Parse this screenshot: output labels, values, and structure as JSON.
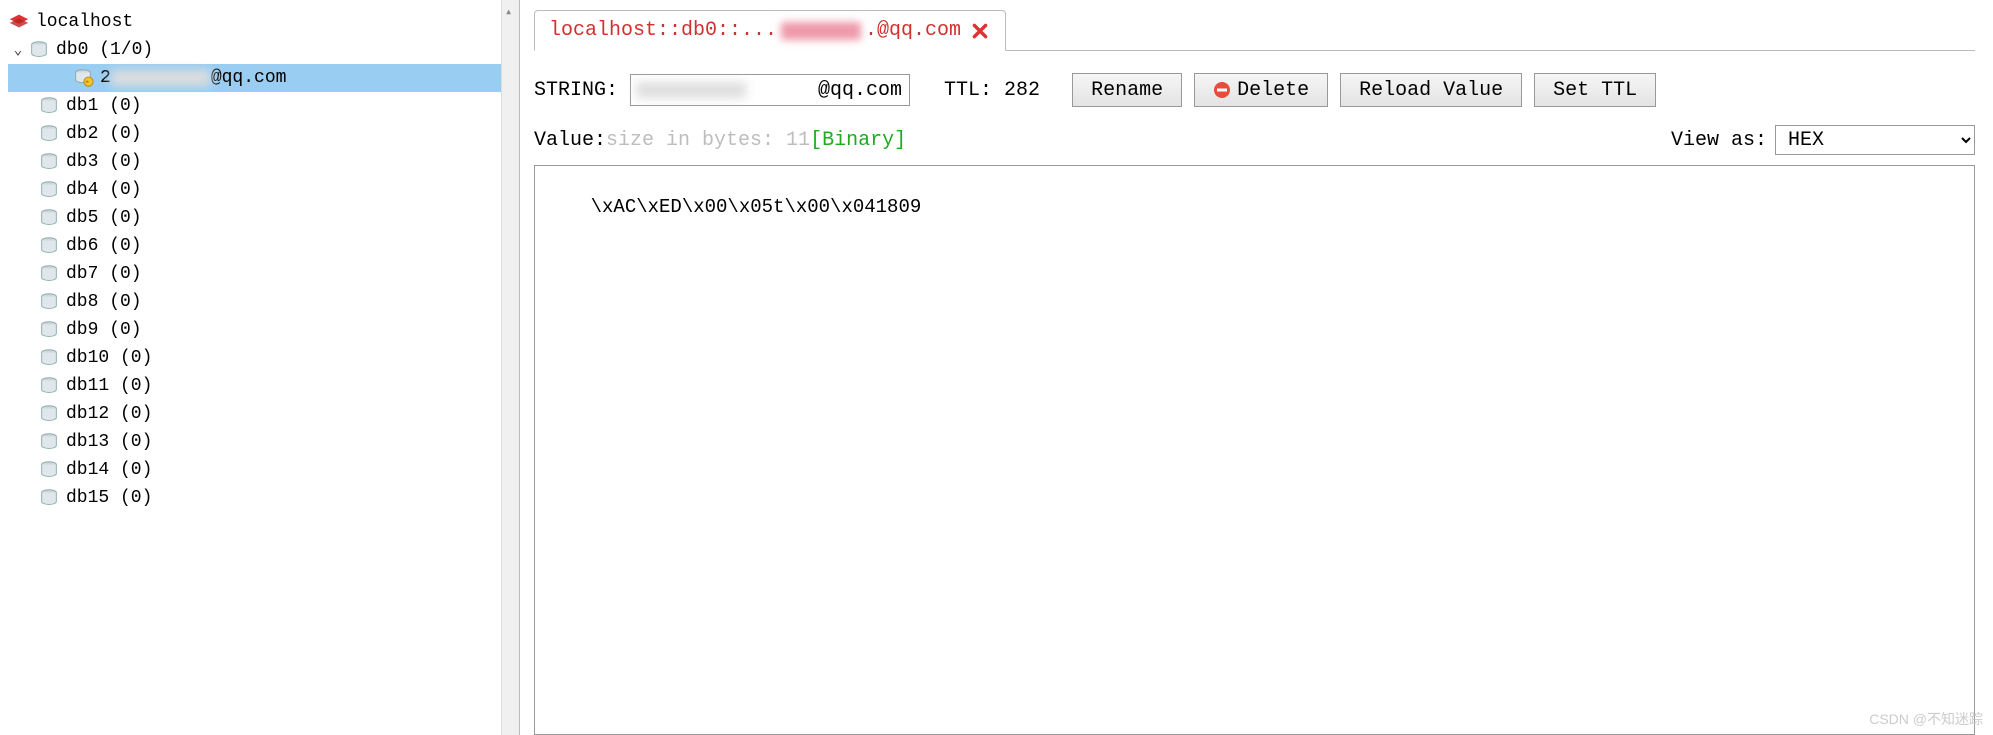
{
  "sidebar": {
    "root_label": "localhost",
    "db0_label": "db0  (1/0)",
    "selected_key_prefix": "2",
    "selected_key_suffix": "@qq.com",
    "dbs": [
      "db1 (0)",
      "db2 (0)",
      "db3 (0)",
      "db4 (0)",
      "db5 (0)",
      "db6 (0)",
      "db7 (0)",
      "db8 (0)",
      "db9 (0)",
      "db10 (0)",
      "db11 (0)",
      "db12 (0)",
      "db13 (0)",
      "db14 (0)",
      "db15 (0)"
    ]
  },
  "tab": {
    "prefix": "localhost::db0::...",
    "suffix": ".@qq.com"
  },
  "details": {
    "string_label": "STRING:",
    "key_value_suffix": "@qq.com",
    "ttl_label": "TTL:",
    "ttl_value": "282",
    "buttons": {
      "rename": "Rename",
      "delete": "Delete",
      "reload": "Reload Value",
      "set_ttl": "Set TTL"
    }
  },
  "value_row": {
    "label": "Value: ",
    "size_text": "size in bytes: 11",
    "binary_text": "[Binary]",
    "view_as_label": "View as:",
    "view_as_value": "HEX"
  },
  "value_content": "\\xAC\\xED\\x00\\x05t\\x00\\x041809",
  "watermark": "CSDN @不知迷踪"
}
